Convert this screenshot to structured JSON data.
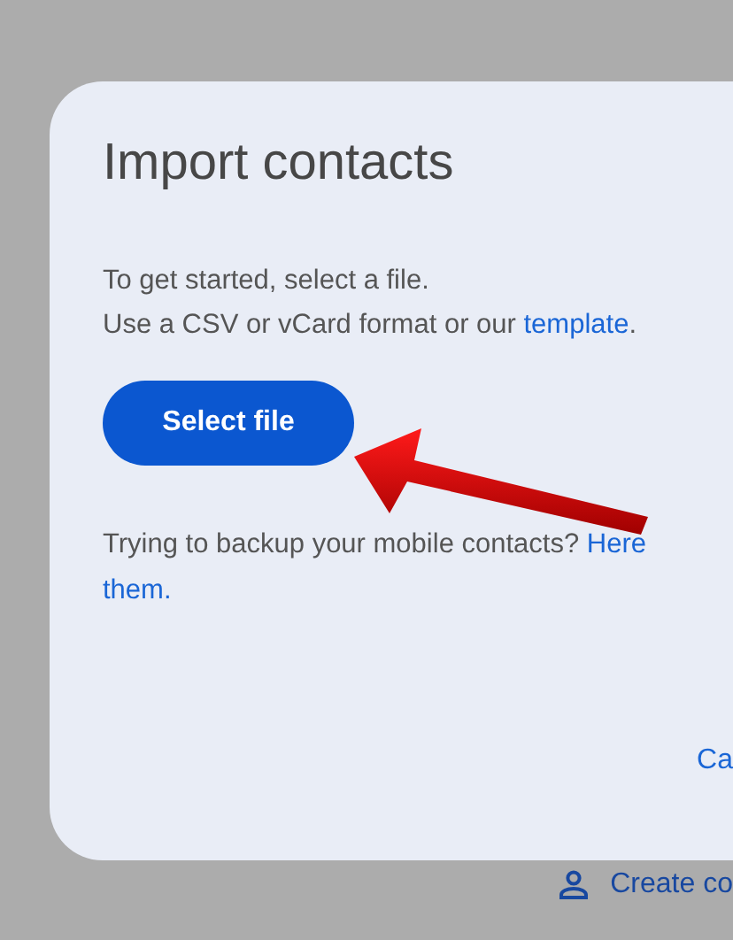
{
  "dialog": {
    "title": "Import contacts",
    "intro_lines": [
      "To get started, select a file.",
      "Use a CSV or vCard format or our "
    ],
    "template_link": "template",
    "intro_end": ".",
    "select_button": "Select file",
    "backup_text": "Trying to backup your mobile contacts? ",
    "backup_links": [
      "Here",
      "them."
    ],
    "cancel_button": "Ca"
  },
  "create_contact": {
    "label": "Create co"
  }
}
